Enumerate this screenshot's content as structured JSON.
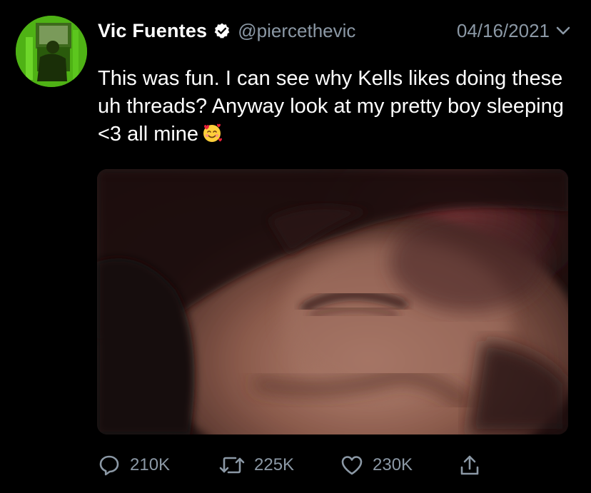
{
  "author": {
    "display_name": "Vic Fuentes",
    "handle": "@piercethevic",
    "verified_icon": "verified-badge-icon",
    "avatar_colors": [
      "#6ccc20",
      "#3aa10f",
      "#1c6a06"
    ]
  },
  "tweet": {
    "date": "04/16/2021",
    "text": "This was fun. I can see why Kells likes doing these uh threads? Anyway look at my pretty boy sleeping <3 all mine",
    "emoji": "smiling-face-with-hearts-emoji",
    "media_kind": "photo"
  },
  "actions": {
    "replies": "210K",
    "retweets": "225K",
    "likes": "230K",
    "reply_icon": "reply-icon",
    "retweet_icon": "retweet-icon",
    "like_icon": "heart-icon",
    "share_icon": "share-icon"
  },
  "colors": {
    "background": "#000000",
    "text_primary": "#ffffff",
    "text_secondary": "#8b98a5"
  }
}
